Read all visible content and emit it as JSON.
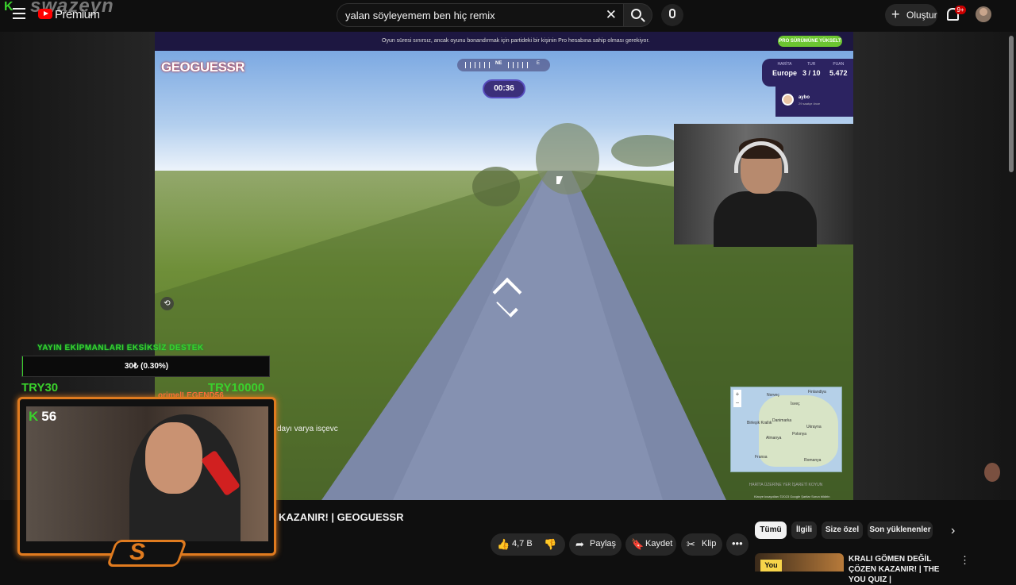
{
  "header": {
    "premium_label": "Premium",
    "channel_overlay_name": "swazeyn",
    "search_query": "yalan söyleyemem ben hiç remix",
    "create_label": "Oluştur",
    "notification_count": "9+"
  },
  "game": {
    "banner_text": "Oyun süresi sınırsız, ancak oyunu bonandırmak için partideki bir kişinin Pro hesabına sahip olması gerekiyor.",
    "pro_button_label": "PRO SÜRÜMÜNE YÜKSELT",
    "logo_text": "GEOGUESSR",
    "compass_label": "NE",
    "compass_label_2": "E",
    "timer": "00:36",
    "stats": {
      "map_label": "HARİTA",
      "map_value": "Europe",
      "round_label": "TUR",
      "round_value": "3 / 10",
      "score_label": "PUAN",
      "score_value": "5.472"
    },
    "player_name": "aybo",
    "player_sub": "29 saatçe önce",
    "map_labels": [
      "Finlandiya",
      "Norveç",
      "İsveç",
      "Danimarka",
      "Birleşik Krallık",
      "Almanya",
      "Polonya",
      "Ukrayna",
      "Fransa",
      "Romanya"
    ],
    "map_button_text": "HARİTA ÜZERİNE YER İŞARETİ KOYUN",
    "map_footer": "Klavye kısayolları  ©2023 Google  Şartlar  Sorun bildirin"
  },
  "overlay": {
    "donation_label": "YAYIN EKİPMANLARI EKSİKSİZ DESTEK",
    "donation_text": "30₺ (0.30%)",
    "donation_progress": 0.003,
    "goal_min": "TRY30",
    "goal_max": "TRY10000",
    "chat_user": "orimelLEGEND56",
    "chat_message": "dayı varya isçevc",
    "kick_viewers": "56"
  },
  "video": {
    "title": "KAZANIR! | GEOGUESSR"
  },
  "actions": {
    "like_count": "4,7 B",
    "share_label": "Paylaş",
    "save_label": "Kaydet",
    "clip_label": "Klip"
  },
  "chips": [
    "Tümü",
    "İlgili",
    "Size özel",
    "Son yüklenenler"
  ],
  "recommendation": {
    "badge": "You",
    "title": "KRALI GÖMEN DEĞİL ÇÖZEN KAZANIR! | THE YOU QUIZ |"
  },
  "colors": {
    "kick_green": "#3ad12c",
    "frame_orange": "#e07b1f",
    "geoguessr_purple": "#2c2361",
    "youtube_red": "#ff0000"
  }
}
